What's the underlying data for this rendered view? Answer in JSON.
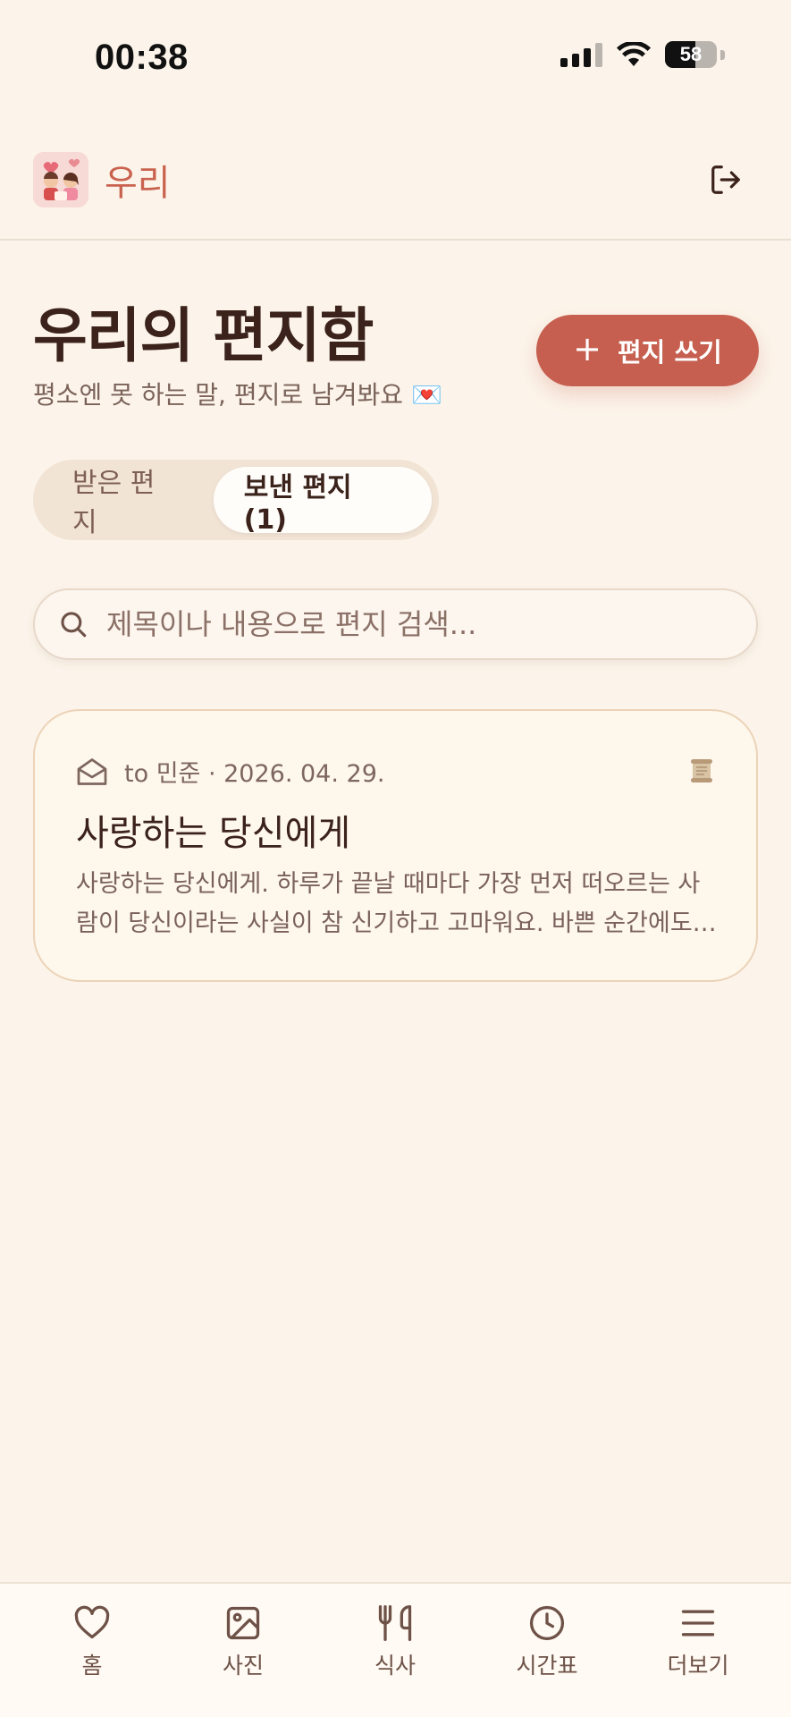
{
  "status_bar": {
    "time": "00:38",
    "battery": "58",
    "battery_level": 0.58
  },
  "header": {
    "app_name": "우리"
  },
  "page": {
    "title": "우리의 편지함",
    "subtitle": "평소엔 못 하는 말, 편지로 남겨봐요 💌",
    "write_button": "편지 쓰기"
  },
  "tabs": [
    {
      "label": "받은 편지",
      "active": false
    },
    {
      "label": "보낸 편지 (1)",
      "active": true
    }
  ],
  "search": {
    "placeholder": "제목이나 내용으로 편지 검색..."
  },
  "letters": [
    {
      "meta": "to 민준 · 2026. 04. 29.",
      "title": "사랑하는 당신에게",
      "preview": "사랑하는 당신에게. 하루가 끝날 때마다 가장 먼저 떠오르는 사람이 당신이라는 사실이 참 신기하고 고마워요. 바쁜 순간에도 당신 생각을 하면 마음이 편안해져요."
    }
  ],
  "bottom_nav": [
    {
      "label": "홈",
      "icon": "heart-icon"
    },
    {
      "label": "사진",
      "icon": "image-icon"
    },
    {
      "label": "식사",
      "icon": "utensils-icon"
    },
    {
      "label": "시간표",
      "icon": "clock-icon"
    },
    {
      "label": "더보기",
      "icon": "menu-icon"
    }
  ],
  "colors": {
    "background": "#fcf4ea",
    "accent": "#c65f4f",
    "card_border": "#ecd3b8",
    "text_dark": "#3b221b"
  }
}
